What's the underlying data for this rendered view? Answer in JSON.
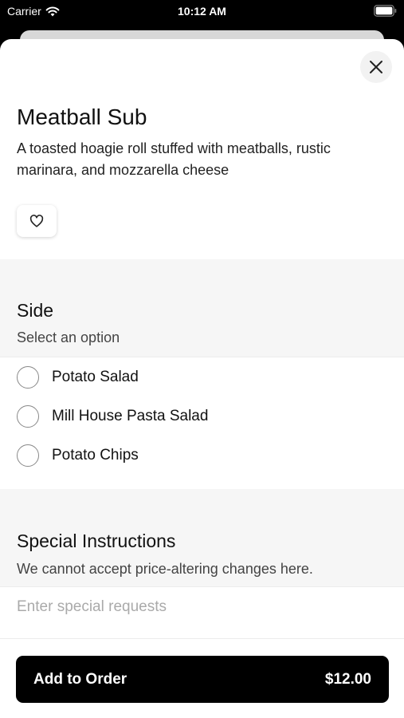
{
  "status_bar": {
    "carrier": "Carrier",
    "time": "10:12 AM"
  },
  "item": {
    "title": "Meatball Sub",
    "description": "A toasted hoagie roll stuffed with meatballs, rustic marinara, and mozzarella cheese"
  },
  "side_section": {
    "heading": "Side",
    "subheading": "Select an option",
    "options": [
      {
        "label": "Potato Salad",
        "selected": false
      },
      {
        "label": "Mill House Pasta Salad",
        "selected": false
      },
      {
        "label": "Potato Chips",
        "selected": false
      }
    ]
  },
  "instructions_section": {
    "heading": "Special Instructions",
    "subheading": "We cannot accept price-altering changes here.",
    "placeholder": "Enter special requests",
    "value": ""
  },
  "add_button": {
    "label": "Add to Order",
    "price": "$12.00"
  },
  "colors": {
    "button_bg": "#000000",
    "section_bg": "#f6f6f6",
    "close_bg": "#f2f2f2"
  },
  "icons": {
    "close": "close-icon",
    "favorite": "heart-icon",
    "wifi": "wifi-icon",
    "battery": "battery-icon"
  }
}
